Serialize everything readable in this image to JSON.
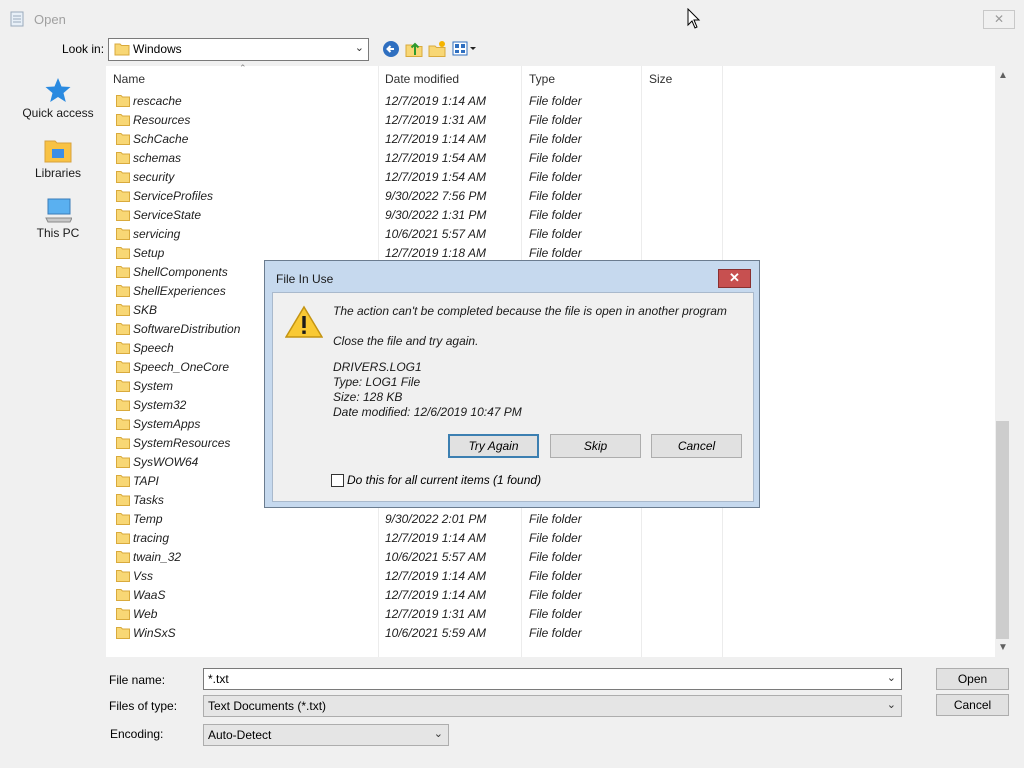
{
  "window": {
    "title": "Open",
    "close_label": "✕"
  },
  "lookin": {
    "label": "Look in:",
    "value": "Windows"
  },
  "toolbar_icons": [
    "back-icon",
    "up-folder-icon",
    "new-folder-icon",
    "view-menu-icon"
  ],
  "places": [
    {
      "label": "Quick access",
      "icon": "star-icon"
    },
    {
      "label": "Libraries",
      "icon": "libraries-icon"
    },
    {
      "label": "This PC",
      "icon": "computer-icon"
    }
  ],
  "columns": {
    "name": "Name",
    "date": "Date modified",
    "type": "Type",
    "size": "Size"
  },
  "files": [
    {
      "name": "rescache",
      "date": "12/7/2019 1:14 AM",
      "type": "File folder"
    },
    {
      "name": "Resources",
      "date": "12/7/2019 1:31 AM",
      "type": "File folder"
    },
    {
      "name": "SchCache",
      "date": "12/7/2019 1:14 AM",
      "type": "File folder"
    },
    {
      "name": "schemas",
      "date": "12/7/2019 1:54 AM",
      "type": "File folder"
    },
    {
      "name": "security",
      "date": "12/7/2019 1:54 AM",
      "type": "File folder"
    },
    {
      "name": "ServiceProfiles",
      "date": "9/30/2022 7:56 PM",
      "type": "File folder"
    },
    {
      "name": "ServiceState",
      "date": "9/30/2022 1:31 PM",
      "type": "File folder"
    },
    {
      "name": "servicing",
      "date": "10/6/2021 5:57 AM",
      "type": "File folder"
    },
    {
      "name": "Setup",
      "date": "12/7/2019 1:18 AM",
      "type": "File folder"
    },
    {
      "name": "ShellComponents",
      "date": "",
      "type": ""
    },
    {
      "name": "ShellExperiences",
      "date": "",
      "type": ""
    },
    {
      "name": "SKB",
      "date": "",
      "type": ""
    },
    {
      "name": "SoftwareDistribution",
      "date": "",
      "type": ""
    },
    {
      "name": "Speech",
      "date": "",
      "type": ""
    },
    {
      "name": "Speech_OneCore",
      "date": "",
      "type": ""
    },
    {
      "name": "System",
      "date": "",
      "type": ""
    },
    {
      "name": "System32",
      "date": "",
      "type": ""
    },
    {
      "name": "SystemApps",
      "date": "",
      "type": ""
    },
    {
      "name": "SystemResources",
      "date": "",
      "type": ""
    },
    {
      "name": "SysWOW64",
      "date": "",
      "type": ""
    },
    {
      "name": "TAPI",
      "date": "",
      "type": ""
    },
    {
      "name": "Tasks",
      "date": "",
      "type": ""
    },
    {
      "name": "Temp",
      "date": "9/30/2022 2:01 PM",
      "type": "File folder"
    },
    {
      "name": "tracing",
      "date": "12/7/2019 1:14 AM",
      "type": "File folder"
    },
    {
      "name": "twain_32",
      "date": "10/6/2021 5:57 AM",
      "type": "File folder"
    },
    {
      "name": "Vss",
      "date": "12/7/2019 1:14 AM",
      "type": "File folder"
    },
    {
      "name": "WaaS",
      "date": "12/7/2019 1:14 AM",
      "type": "File folder"
    },
    {
      "name": "Web",
      "date": "12/7/2019 1:31 AM",
      "type": "File folder"
    },
    {
      "name": "WinSxS",
      "date": "10/6/2021 5:59 AM",
      "type": "File folder"
    }
  ],
  "filename": {
    "label": "File name:",
    "value": "*.txt"
  },
  "filetype": {
    "label": "Files of type:",
    "value": "Text Documents (*.txt)"
  },
  "encoding": {
    "label": "Encoding:",
    "value": "Auto-Detect"
  },
  "buttons": {
    "open": "Open",
    "cancel": "Cancel"
  },
  "dialog": {
    "title": "File In Use",
    "close_label": "✕",
    "message": "The action can't be completed because the file is open in another program",
    "instruction": "Close the file and try again.",
    "file_name": "DRIVERS.LOG1",
    "file_type": "Type: LOG1 File",
    "file_size": "Size: 128 KB",
    "file_date": "Date modified: 12/6/2019 10:47 PM",
    "try_again": "Try Again",
    "skip": "Skip",
    "cancel": "Cancel",
    "checkbox_label": "Do this for all current items (1 found)"
  }
}
